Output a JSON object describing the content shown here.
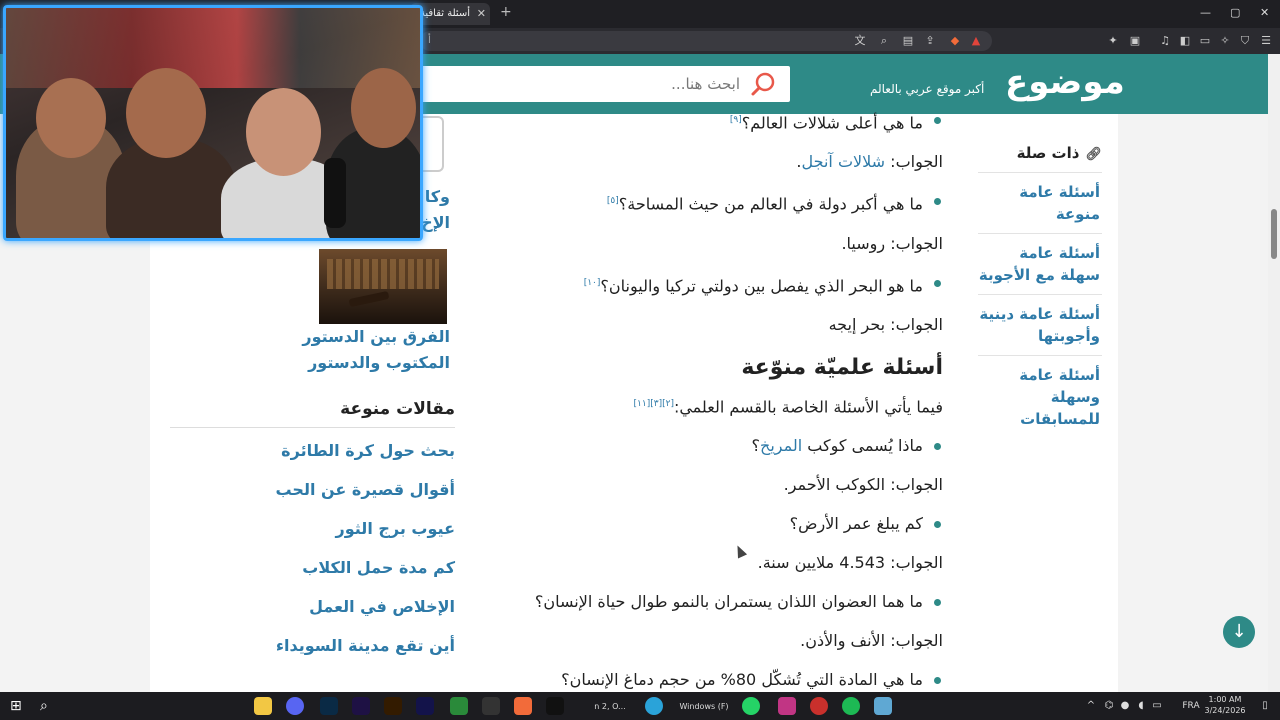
{
  "browser": {
    "tab_title": "أسئلة ثقافية",
    "tab_close": "✕",
    "new_tab": "+",
    "url": "أ"
  },
  "header": {
    "logo": "موضوع",
    "tagline": "أكبر موقع عربي بالعالم",
    "search_placeholder": "ابحث هنا..."
  },
  "related": {
    "title": "ذات صلة",
    "items": [
      "أسئلة عامة منوعة",
      "أسئلة عامة سهلة مع الأجوبة",
      "أسئلة عامة دينية وأجوبتها",
      "أسئلة عامة وسهلة للمسابقات"
    ]
  },
  "article": {
    "q1": "ما هي أعلى شلالات العالم؟",
    "q1_ref": "[٩]",
    "a1_prefix": "الجواب: ",
    "a1_link": "شلالات آنجل",
    "a1_suffix": ".",
    "q2": "ما هي أكبر دولة في العالم من حيث المساحة؟",
    "q2_ref": "[٥]",
    "a2": "الجواب: روسيا.",
    "q3": "ما هو البحر الذي يفصل بين دولتي تركيا واليونان؟",
    "q3_ref": "[١٠]",
    "a3": "الجواب: بحر إيجه",
    "heading": "أسئلة علميّة منوّعة",
    "intro": "فيما يأتي الأسئلة الخاصة بالقسم العلمي:",
    "intro_ref": "[٢][٣][١١]",
    "q4_prefix": "ماذا يُسمى كوكب ",
    "q4_link": "المريخ",
    "q4_suffix": "؟",
    "a4": "الجواب: الكوكب الأحمر.",
    "q5": "كم يبلغ عمر الأرض؟",
    "a5": "الجواب: 4.543 ملايين سنة.",
    "q6": "ما هما العضوان اللذان يستمران بالنمو طوال حياة الإنسان؟",
    "a6": "الجواب: الأنف والأذن.",
    "q7": "ما هي المادة التي تُشكّل 80% من حجم دماغ الإنسان؟"
  },
  "left": {
    "prev_title_line1": "وكا",
    "prev_title_line2": "الإخ",
    "card_title": "الفرق بين الدستور المكتوب والدستور",
    "misc_title": "مقالات منوعة",
    "misc_items": [
      "بحث حول كرة الطائرة",
      "أقوال قصيرة عن الحب",
      "عيوب برج الثور",
      "كم مدة حمل الكلاب",
      "الإخلاص في العمل",
      "أين تقع مدينة السويداء"
    ]
  },
  "taskbar": {
    "lang": "FRA",
    "time": "1:00 AM",
    "date": "3/24/2026",
    "task_label_1": "Windows (F)",
    "task_label_2": "n 2, O..."
  },
  "colors": {
    "brand": "#2e8a87",
    "link": "#2e7aa8",
    "webcam_border": "#3aa7ff"
  }
}
